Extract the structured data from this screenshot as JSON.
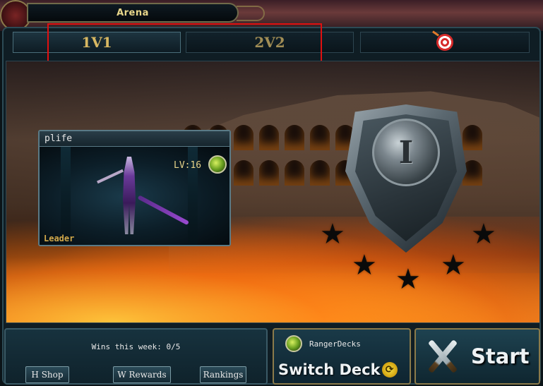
{
  "header": {
    "title": "Arena"
  },
  "tabs": [
    {
      "label": "1V1",
      "active": true
    },
    {
      "label": "2V2",
      "active": false
    },
    {
      "label": "",
      "icon": "target-icon",
      "active": false
    }
  ],
  "character": {
    "name": "plife",
    "level": "LV:16",
    "role": "Leader",
    "class_icon": "ranger-class-icon"
  },
  "rank": {
    "numeral": "I",
    "icon": "rank-shield-icon",
    "stars_filled": 0,
    "stars_total": 5
  },
  "stats": {
    "wins_text": "Wins this week: 0/5"
  },
  "buttons": {
    "shop": "H Shop",
    "rewards": "W Rewards",
    "rankings": "Rankings",
    "switch_deck": "Switch Deck",
    "start": "Start"
  },
  "deck": {
    "name": "RangerDecks"
  },
  "colors": {
    "gold_text": "#d8b862",
    "highlight_box": "#e01010",
    "panel_border": "#3a5a66"
  }
}
